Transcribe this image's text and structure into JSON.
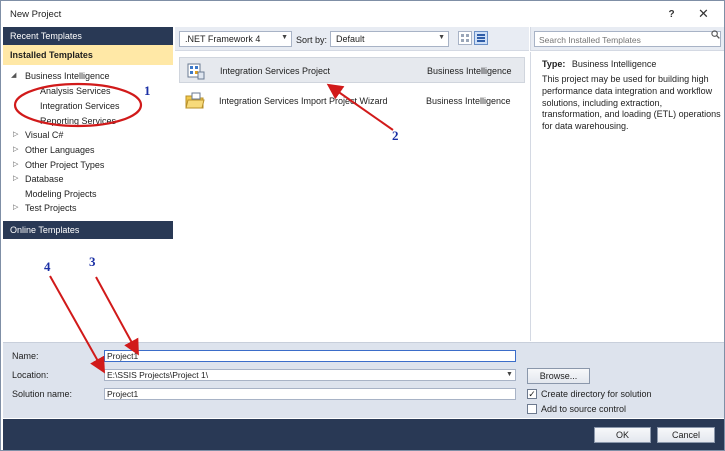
{
  "window": {
    "title": "New Project",
    "help_label": "?",
    "close_label": "✕"
  },
  "left_pane": {
    "recent_templates": "Recent Templates",
    "installed_templates": "Installed Templates",
    "tree": [
      {
        "label": "Business Intelligence",
        "expanded": true,
        "level": 0
      },
      {
        "label": "Analysis Services",
        "level": 1
      },
      {
        "label": "Integration Services",
        "level": 1
      },
      {
        "label": "Reporting Services",
        "level": 1
      },
      {
        "label": "Visual C#",
        "expanded": false,
        "level": 0
      },
      {
        "label": "Other Languages",
        "expanded": false,
        "level": 0
      },
      {
        "label": "Other Project Types",
        "expanded": false,
        "level": 0
      },
      {
        "label": "Database",
        "expanded": false,
        "level": 0
      },
      {
        "label": "Modeling Projects",
        "level": 0
      },
      {
        "label": "Test Projects",
        "expanded": false,
        "level": 0
      }
    ],
    "online_templates": "Online Templates"
  },
  "toolbar": {
    "framework": ".NET Framework 4",
    "sort_by_label": "Sort by:",
    "sort_by_value": "Default",
    "search_placeholder": "Search Installed Templates"
  },
  "templates": [
    {
      "name": "Integration Services Project",
      "category": "Business Intelligence",
      "selected": true,
      "icon": "ssis-project-icon"
    },
    {
      "name": "Integration Services Import Project Wizard",
      "category": "Business Intelligence",
      "selected": false,
      "icon": "import-wizard-folder-icon"
    }
  ],
  "details": {
    "type_label": "Type:",
    "type_value": "Business Intelligence",
    "description": "This project may be used for building high performance data integration and workflow solutions, including extraction, transformation, and loading (ETL) operations for data warehousing."
  },
  "form": {
    "name_label": "Name:",
    "name_value": "Project1",
    "location_label": "Location:",
    "location_value": "E:\\SSIS Projects\\Project 1\\",
    "solution_name_label": "Solution name:",
    "solution_name_value": "Project1",
    "browse_label": "Browse...",
    "create_directory_label": "Create directory for solution",
    "create_directory_checked": true,
    "add_source_control_label": "Add to source control",
    "add_source_control_checked": false
  },
  "buttons": {
    "ok": "OK",
    "cancel": "Cancel"
  },
  "annotations": {
    "callout_1": "1",
    "callout_2": "2",
    "callout_3": "3",
    "callout_4": "4",
    "color": "#d11a1a",
    "number_color": "#1a2fa5"
  },
  "colors": {
    "header_dark": "#293955",
    "installed_highlight": "#ffe8a6",
    "bottom_panel": "#dde3ed"
  }
}
